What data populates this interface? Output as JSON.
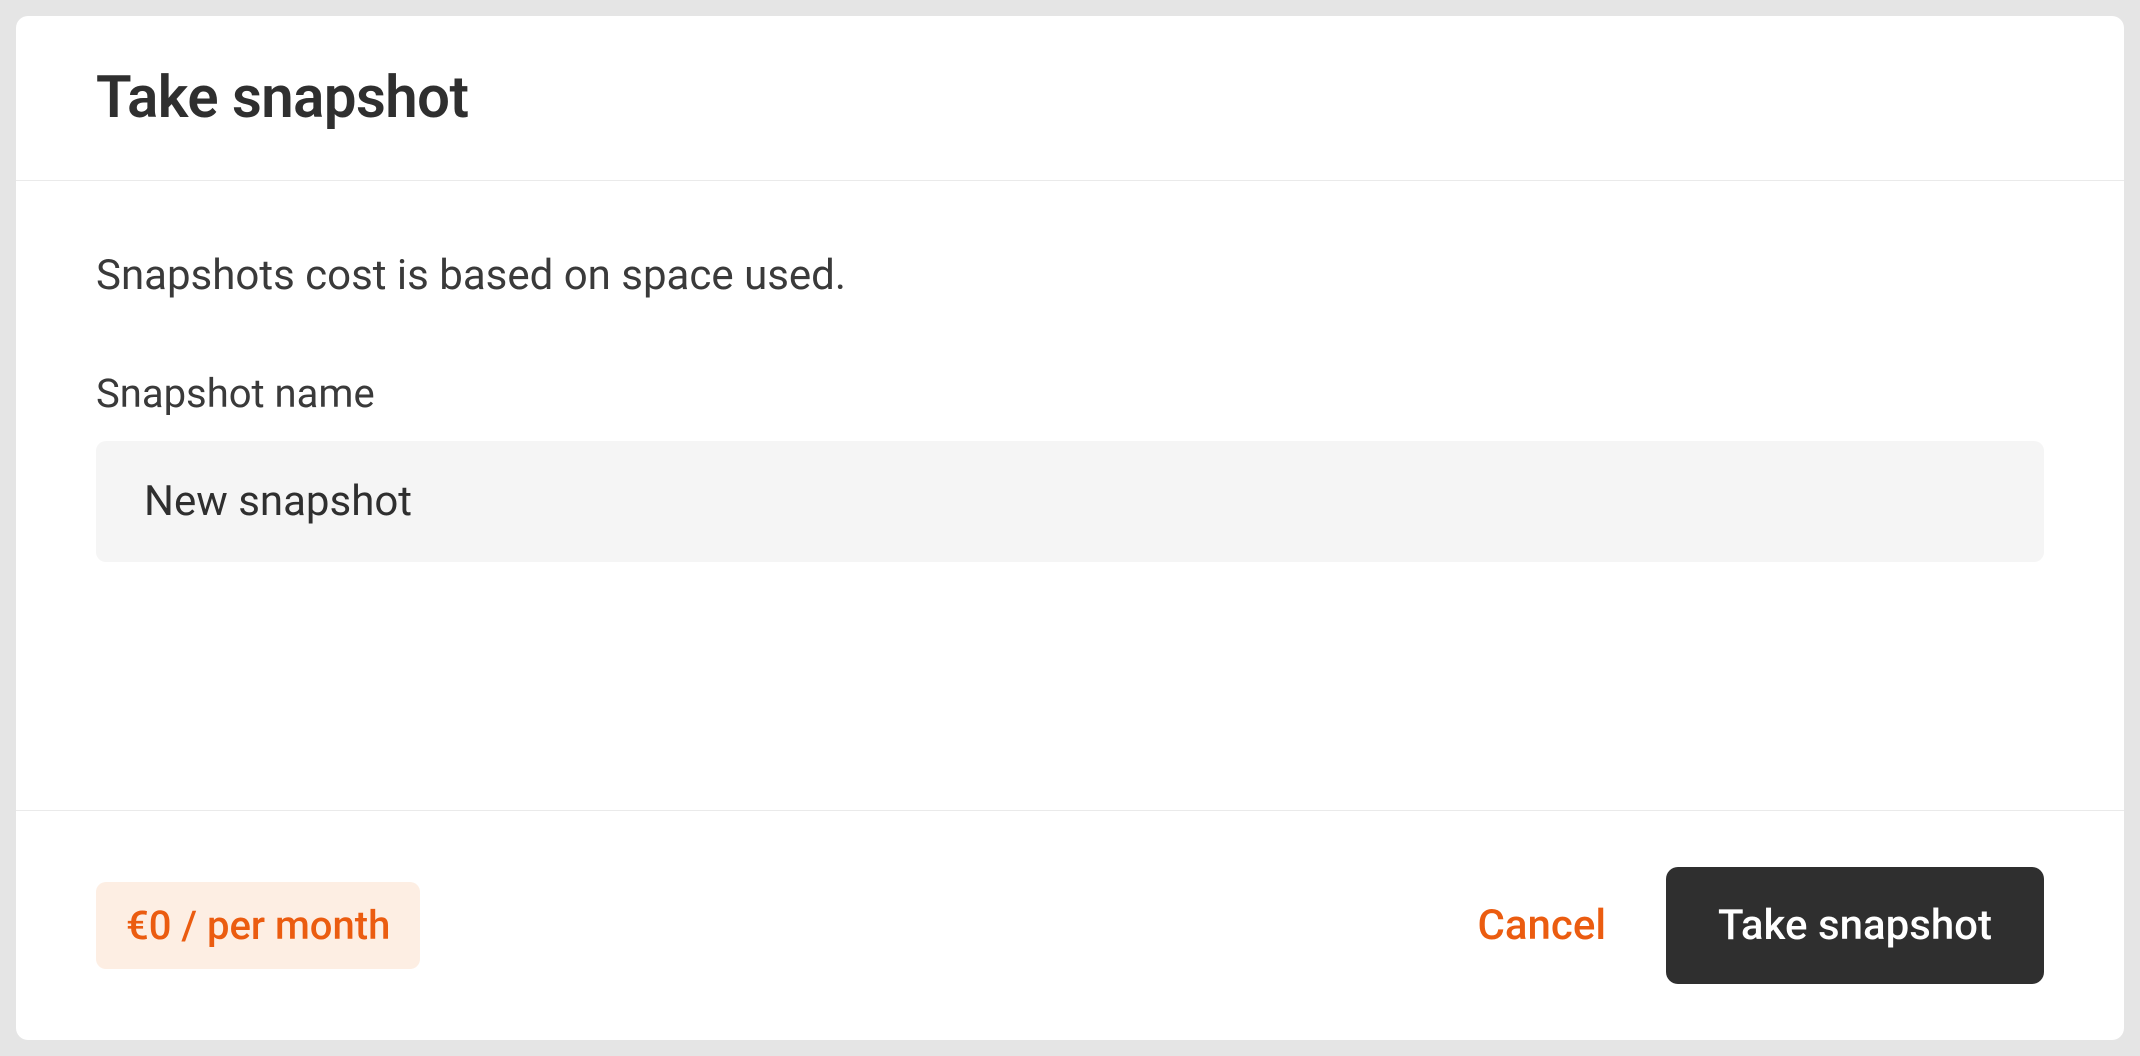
{
  "dialog": {
    "title": "Take snapshot",
    "description": "Snapshots cost is based on space used.",
    "field_label": "Snapshot name",
    "input_value": "New snapshot"
  },
  "footer": {
    "price_badge": "€0 / per month",
    "cancel_label": "Cancel",
    "primary_label": "Take snapshot"
  },
  "colors": {
    "accent": "#eb5c10",
    "badge_bg": "#fdeee3",
    "primary_button_bg": "#2f2f2f",
    "input_bg": "#f5f5f5",
    "divider": "#eaeaea"
  }
}
